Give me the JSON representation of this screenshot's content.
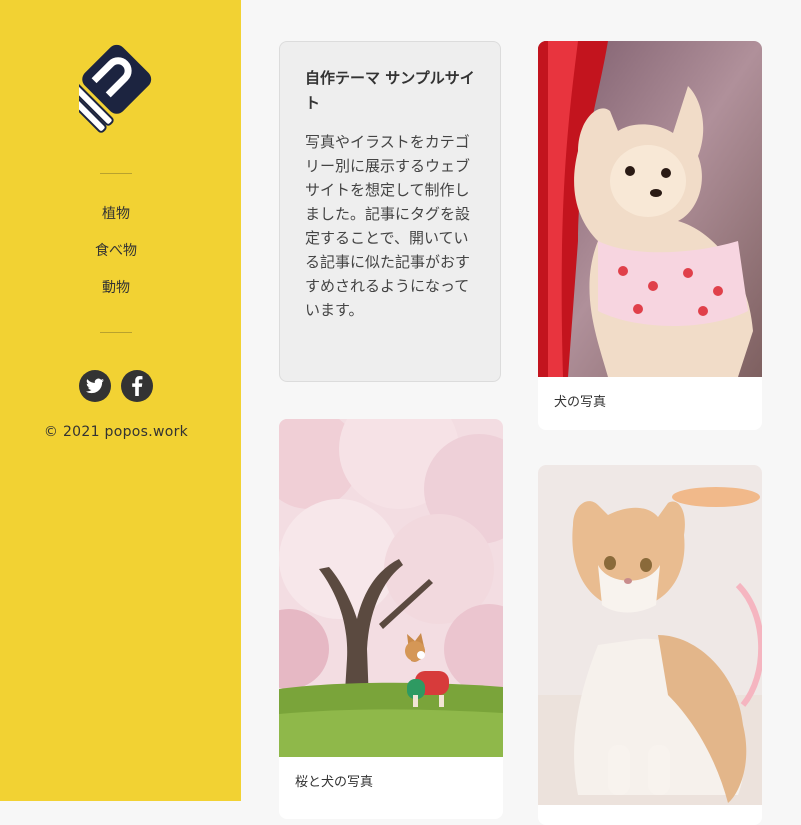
{
  "sidebar": {
    "nav": [
      {
        "label": "植物"
      },
      {
        "label": "食べ物"
      },
      {
        "label": "動物"
      }
    ],
    "social": [
      "twitter-icon",
      "facebook-icon"
    ],
    "copyright": "© 2021 popos.work"
  },
  "intro": {
    "title": "自作テーマ サンプルサイト",
    "body": "写真やイラストをカテゴリー別に展示するウェブサイトを想定して制作しました。記事にタグを設定することで、開いている記事に似た記事がおすすめされるようになっています。"
  },
  "posts": [
    {
      "caption": "犬の写真"
    },
    {
      "caption": "桜と犬の写真"
    },
    {
      "caption": ""
    }
  ],
  "colors": {
    "sidebar": "#f2d233",
    "accent_dark": "#1c2440"
  }
}
